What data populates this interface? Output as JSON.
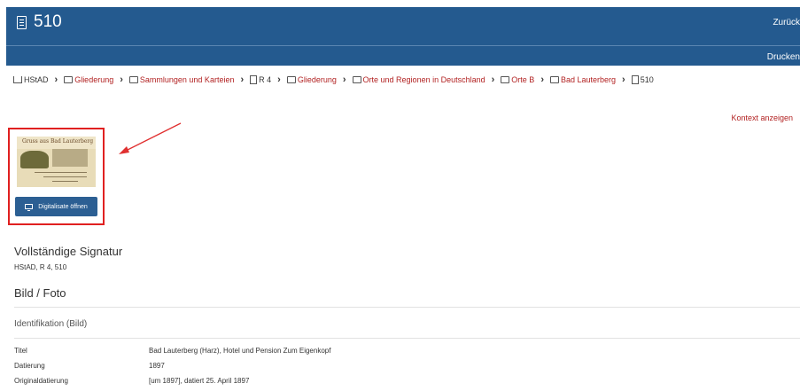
{
  "header": {
    "title": "510",
    "back_label": "Zurück",
    "print_label": "Drucken"
  },
  "breadcrumb": [
    {
      "label": "HStAD",
      "icon": "home-icon"
    },
    {
      "label": "Gliederung",
      "icon": "folder-icon"
    },
    {
      "label": "Sammlungen und Karteien",
      "icon": "folder-icon"
    },
    {
      "label": "R 4",
      "icon": "file-icon"
    },
    {
      "label": "Gliederung",
      "icon": "folder-icon"
    },
    {
      "label": "Orte und Regionen in Deutschland",
      "icon": "folder-icon"
    },
    {
      "label": "Orte B",
      "icon": "folder-icon"
    },
    {
      "label": "Bad Lauterberg",
      "icon": "folder-icon"
    },
    {
      "label": "510",
      "icon": "document-icon"
    }
  ],
  "context_link": "Kontext anzeigen",
  "thumbnail": {
    "button_label": "Digitalisate öffnen",
    "caption": "Gruss aus Bad Lauterberg"
  },
  "signature": {
    "heading": "Vollständige Signatur",
    "value": "HStAD, R 4, 510"
  },
  "section_heading": "Bild / Foto",
  "identification": {
    "heading": "Identifikation (Bild)",
    "rows": [
      {
        "label": "Titel",
        "value": "Bad Lauterberg (Harz), Hotel und Pension Zum Eigenkopf"
      },
      {
        "label": "Datierung",
        "value": "1897"
      },
      {
        "label": "Originaldatierung",
        "value": "[um 1897], datiert 25. April 1897"
      }
    ]
  },
  "colors": {
    "header_bg": "#245a8f",
    "link": "#b22222",
    "highlight_box": "#e02020",
    "button_bg": "#2c5f93"
  }
}
